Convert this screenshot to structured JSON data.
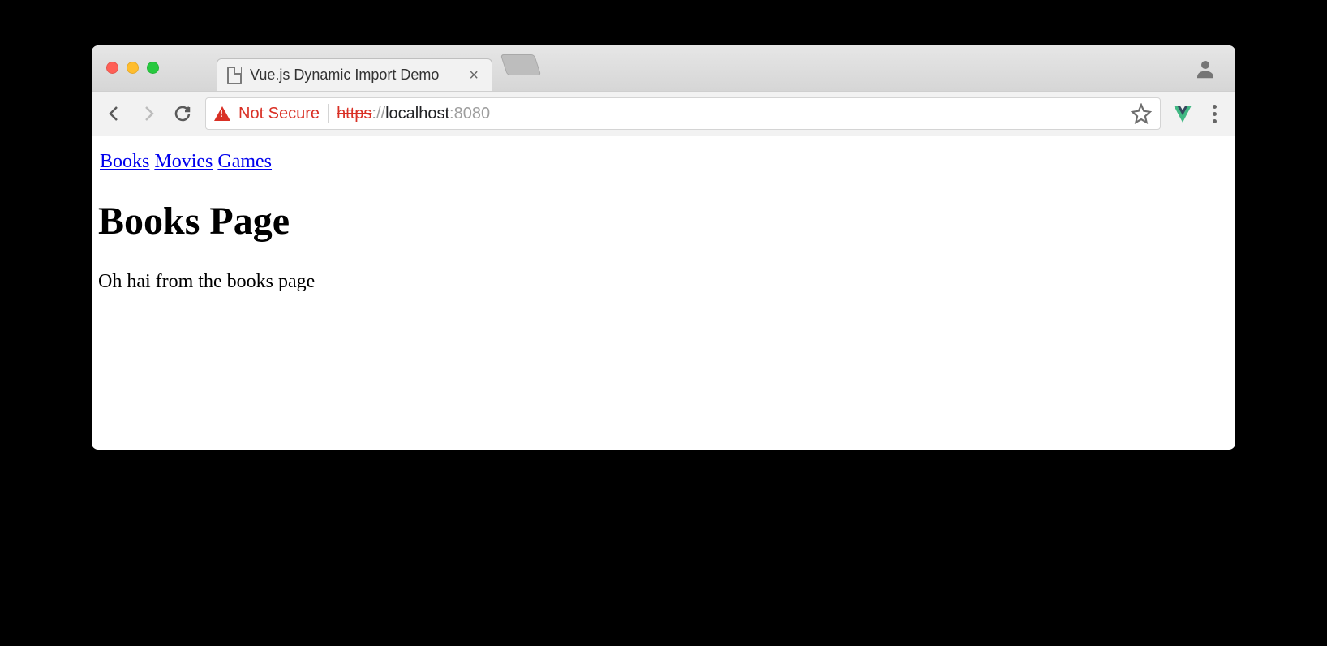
{
  "browser": {
    "tab_title": "Vue.js Dynamic Import Demo",
    "security_label": "Not Secure",
    "url": {
      "scheme": "https",
      "scheme_sep": "://",
      "host": "localhost",
      "port_sep": ":",
      "port": "8080"
    }
  },
  "page": {
    "nav_links": [
      "Books",
      "Movies",
      "Games"
    ],
    "heading": "Books Page",
    "body_text": "Oh hai from the books page"
  }
}
